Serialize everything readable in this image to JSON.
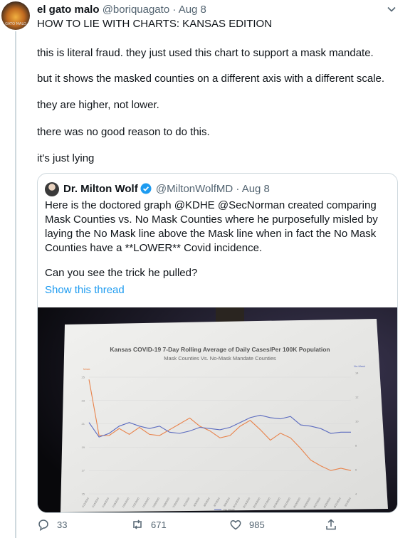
{
  "tweet": {
    "author_name": "el gato malo",
    "author_handle": "@boriquagato",
    "separator": "·",
    "date": "Aug 8",
    "avatar_caption": "GATO MALO",
    "title_line": "HOW TO LIE WITH CHARTS:  KANSAS EDITION",
    "paragraphs": [
      "this is literal fraud.  they just used this chart to support a mask mandate.",
      "but it shows the masked counties on a different axis with a different scale.",
      "they are higher, not lower.",
      "there was no good reason to do this.",
      "it's just lying"
    ]
  },
  "quoted": {
    "author_name": "Dr. Milton Wolf",
    "author_handle": "@MiltonWolfMD",
    "separator": "·",
    "date": "Aug 8",
    "lines": [
      "Here is the doctored graph @KDHE @SecNorman created comparing",
      "Mask Counties vs. No Mask Counties where he purposefully misled by",
      "laying the No Mask line above the Mask line when in fact the No Mask",
      "Counties have a **LOWER** Covid incidence."
    ],
    "question": "Can you see the trick he pulled?",
    "show_thread": "Show this thread",
    "photo": {
      "title": "Kansas COVID-19 7-Day Rolling Average of Daily Cases/Per 100K Population",
      "subtitle": "Mask Counties Vs. No-Mask Mandate Counties",
      "left_axis_label": "Mask",
      "right_axis_label": "No-Mask",
      "left_ticks": [
        "25",
        "23",
        "21",
        "19",
        "17",
        "15"
      ],
      "right_ticks": [
        "14",
        "12",
        "10",
        "8",
        "6",
        "4"
      ],
      "x_dates": [
        "7/12/2020",
        "7/14/2020",
        "7/16/2020",
        "7/18/2020",
        "7/20/2020",
        "7/22/2020",
        "7/24/2020",
        "7/26/2020",
        "7/28/2020",
        "7/30/2020",
        "8/1/2020",
        "8/3/2020",
        "8/5/2020",
        "8/7/2020",
        "8/9/2020",
        "8/11/2020",
        "8/13/2020",
        "8/15/2020",
        "8/17/2020",
        "8/19/2020",
        "8/21/2020",
        "8/23/2020",
        "8/25/2020",
        "8/27/2020",
        "8/29/2020",
        "8/31/2020",
        "9/1/2020"
      ],
      "legend_label": "No Mask",
      "colors": {
        "mask": "#e8824a",
        "no_mask": "#5b6bbf"
      },
      "mask_series": [
        24.8,
        20.0,
        20.0,
        20.6,
        20.1,
        20.7,
        20.1,
        20.0,
        20.5,
        21.0,
        21.5,
        20.8,
        20.4,
        19.8,
        20.0,
        20.8,
        21.3,
        20.5,
        19.6,
        20.2,
        19.8,
        18.9,
        17.9,
        17.4,
        17.0,
        17.2,
        17.0
      ],
      "no_mask_series": [
        9.9,
        8.7,
        9.0,
        9.6,
        9.9,
        9.6,
        9.4,
        9.6,
        9.1,
        9.0,
        9.2,
        9.5,
        9.4,
        9.3,
        9.5,
        9.9,
        10.3,
        10.5,
        10.3,
        10.2,
        10.4,
        9.7,
        9.6,
        9.4,
        9.0,
        9.1,
        9.1
      ]
    }
  },
  "actions": {
    "replies": "33",
    "retweets": "671",
    "likes": "985"
  }
}
